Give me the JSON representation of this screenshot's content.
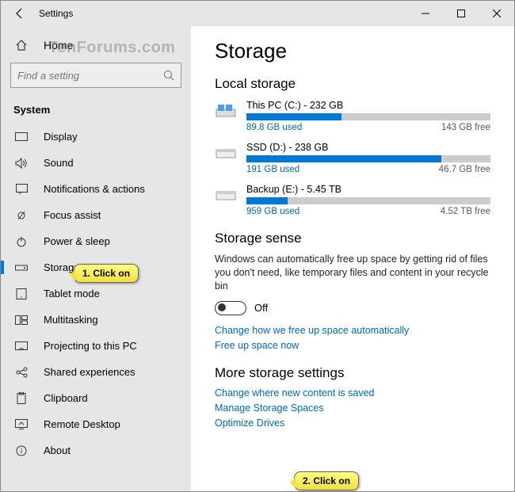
{
  "window": {
    "title": "Settings"
  },
  "watermark": "TenForums.com",
  "sidebar": {
    "home": "Home",
    "search_placeholder": "Find a setting",
    "section": "System",
    "items": [
      {
        "label": "Display"
      },
      {
        "label": "Sound"
      },
      {
        "label": "Notifications & actions"
      },
      {
        "label": "Focus assist"
      },
      {
        "label": "Power & sleep"
      },
      {
        "label": "Storage"
      },
      {
        "label": "Tablet mode"
      },
      {
        "label": "Multitasking"
      },
      {
        "label": "Projecting to this PC"
      },
      {
        "label": "Shared experiences"
      },
      {
        "label": "Clipboard"
      },
      {
        "label": "Remote Desktop"
      },
      {
        "label": "About"
      }
    ]
  },
  "page": {
    "title": "Storage",
    "local_heading": "Local storage",
    "drives": [
      {
        "title": "This PC (C:) - 232 GB",
        "used": "89.8 GB used",
        "free": "143 GB free",
        "pct": 39
      },
      {
        "title": "SSD (D:) - 238 GB",
        "used": "191 GB used",
        "free": "46.7 GB free",
        "pct": 80
      },
      {
        "title": "Backup (E:) - 5.45 TB",
        "used": "959 GB used",
        "free": "4.52 TB free",
        "pct": 17
      }
    ],
    "sense_heading": "Storage sense",
    "sense_desc": "Windows can automatically free up space by getting rid of files you don't need, like temporary files and content in your recycle bin",
    "toggle_state": "Off",
    "link_change_auto": "Change how we free up space automatically",
    "link_free_now": "Free up space now",
    "more_heading": "More storage settings",
    "link_new_content": "Change where new content is saved",
    "link_spaces": "Manage Storage Spaces",
    "link_optimize": "Optimize Drives"
  },
  "callouts": {
    "c1": "1. Click on",
    "c2": "2. Click on"
  }
}
